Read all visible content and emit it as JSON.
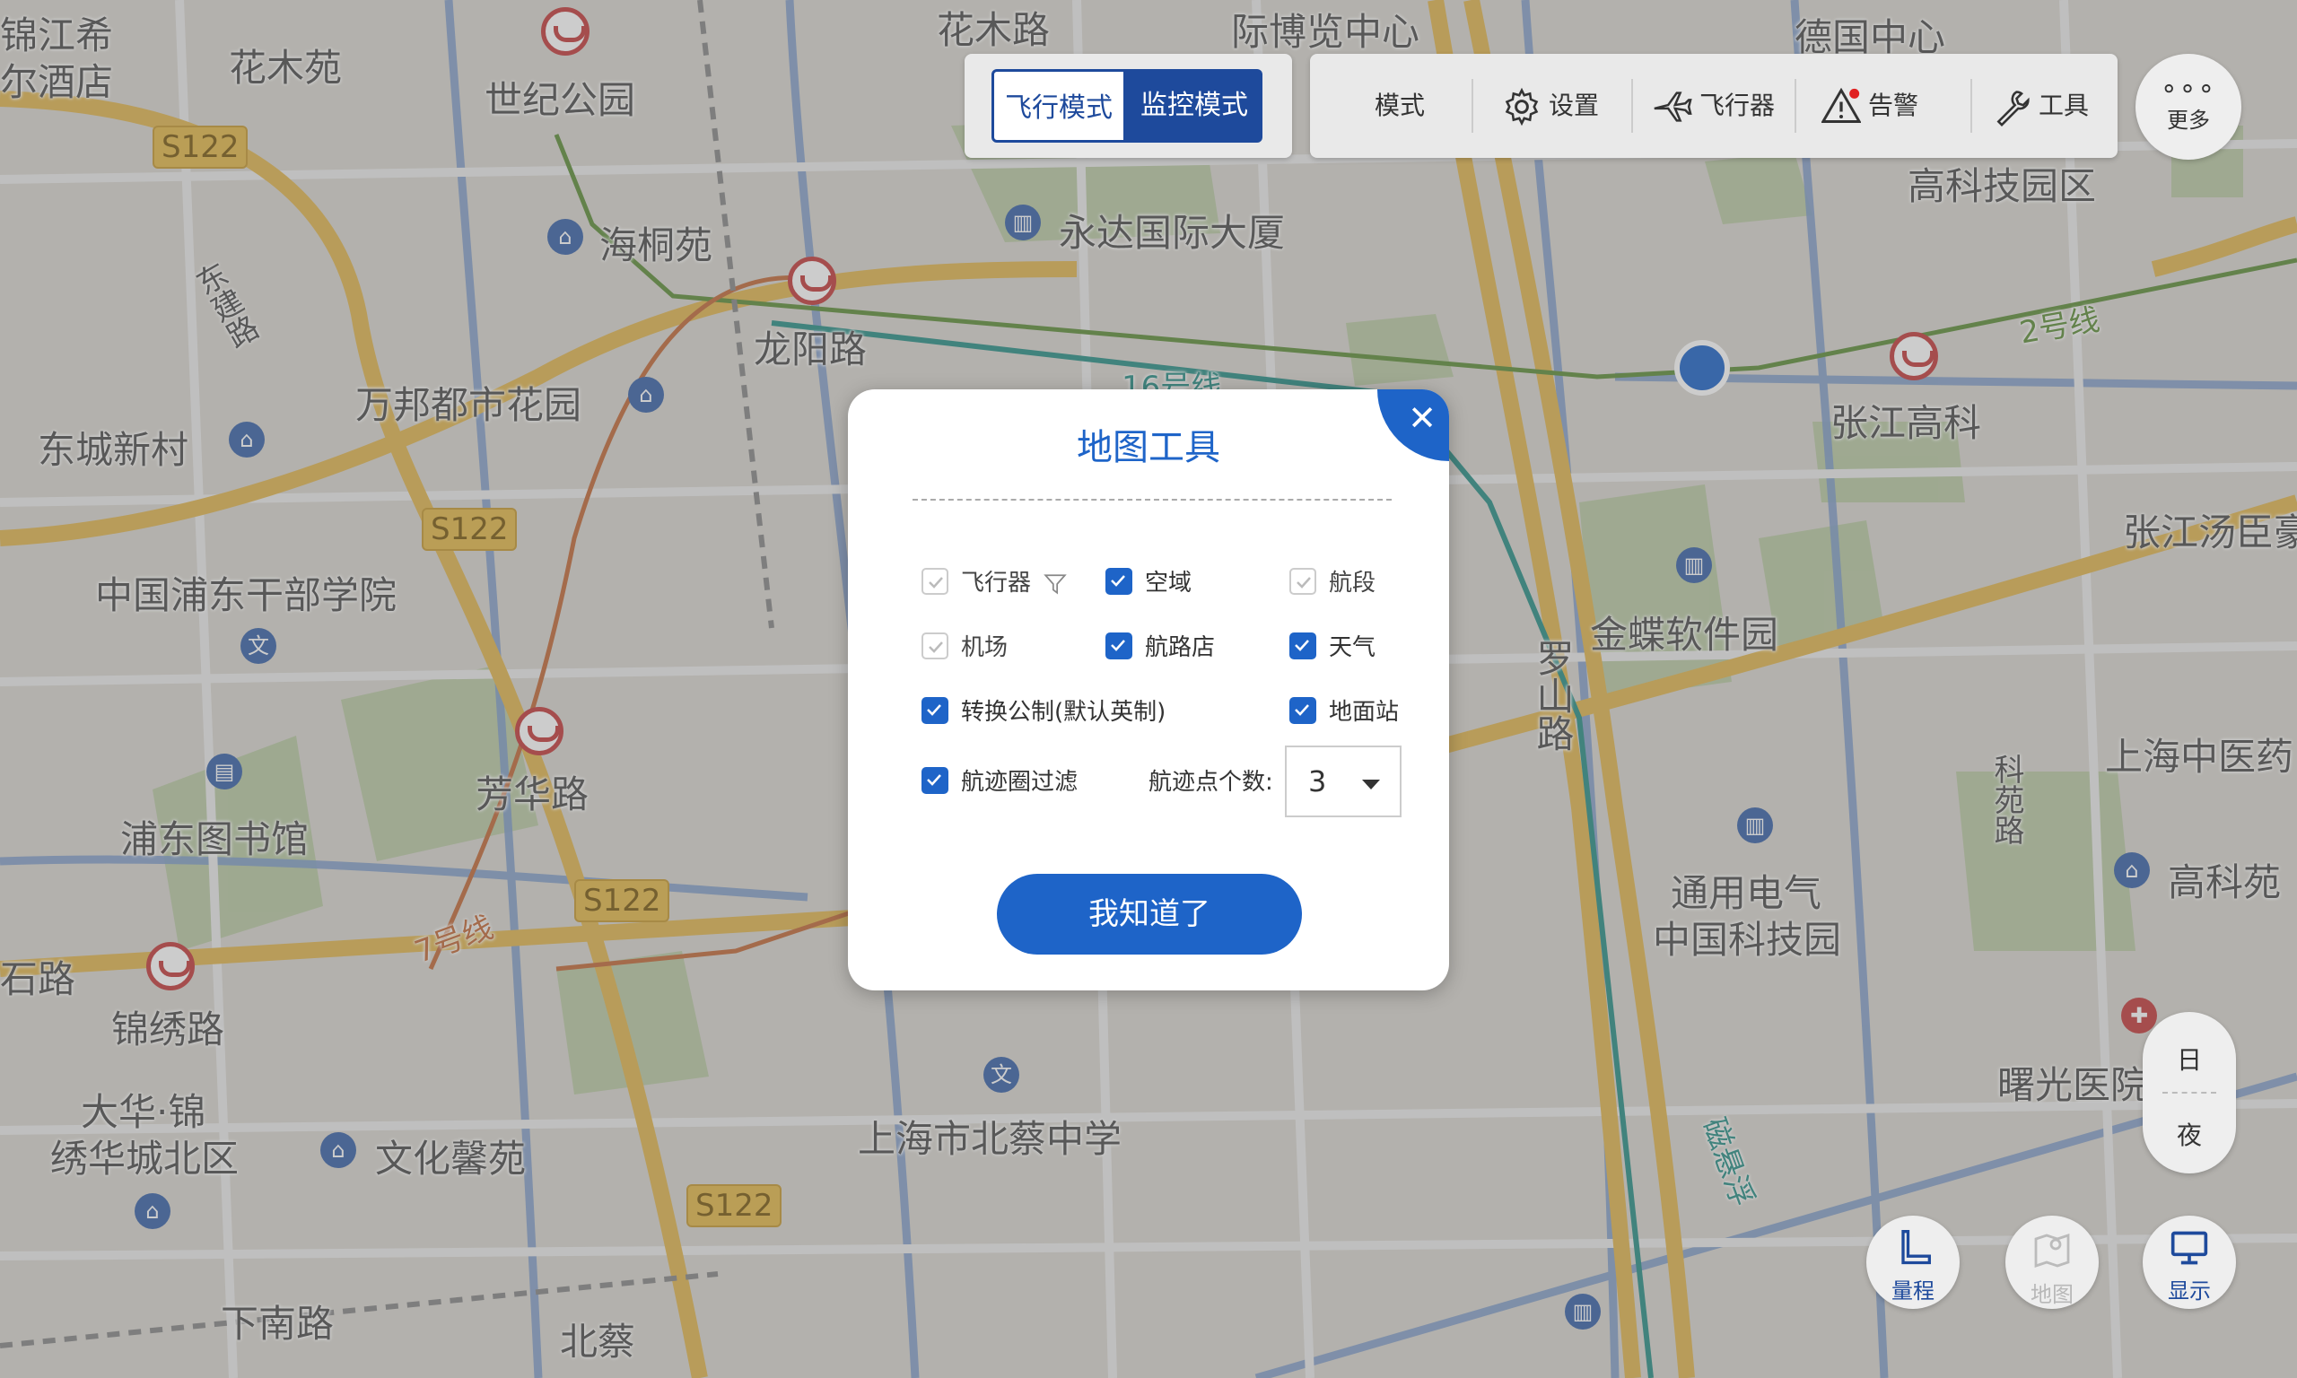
{
  "map": {
    "labels": [
      "花木苑",
      "世纪公园",
      "海桐苑",
      "龙阳路",
      "永达国际大厦",
      "万邦都市花园",
      "东城新村",
      "中国浦东干部学院",
      "芳华路",
      "浦东图书馆",
      "锦绣路",
      "大华·锦",
      "绣华城北区",
      "文化馨苑",
      "下南路",
      "北蔡",
      "上海市北蔡中学",
      "金蝶软件园",
      "张江高科",
      "高科技园区",
      "张江汤臣豪",
      "上海中医药",
      "通用电气",
      "中国科技园",
      "高科苑",
      "曙光医院",
      "德国中心",
      "际博览中心",
      "花木路",
      "锦江希",
      "尔酒店",
      "罗山路",
      "科苑路",
      "东建路",
      "石路",
      "2号线",
      "16号线",
      "7号线",
      "磁悬浮"
    ],
    "road_tags": [
      "S122",
      "S122",
      "S122",
      "S122"
    ]
  },
  "mode_bar": {
    "flight_mode": "飞行模式",
    "monitor_mode": "监控模式"
  },
  "toolbar": {
    "mode": "模式",
    "settings": "设置",
    "aircraft": "飞行器",
    "alarm": "告警",
    "tools": "工具"
  },
  "more": {
    "label": "更多"
  },
  "day_night": {
    "day": "日",
    "night": "夜"
  },
  "bottom_controls": {
    "range": "量程",
    "map": "地图",
    "display": "显示"
  },
  "dialog": {
    "title": "地图工具",
    "options": {
      "aircraft": "飞行器",
      "airspace": "空域",
      "segment": "航段",
      "airport": "机场",
      "waypoint": "航路店",
      "weather": "天气",
      "metric": "转换公制(默认英制)",
      "ground_station": "地面站",
      "track_filter": "航迹圈过滤"
    },
    "track_count_label": "航迹点个数:",
    "track_count_value": "3",
    "ok_button": "我知道了"
  },
  "colors": {
    "accent": "#1e64c8",
    "mode_active": "#1e4a9c"
  }
}
